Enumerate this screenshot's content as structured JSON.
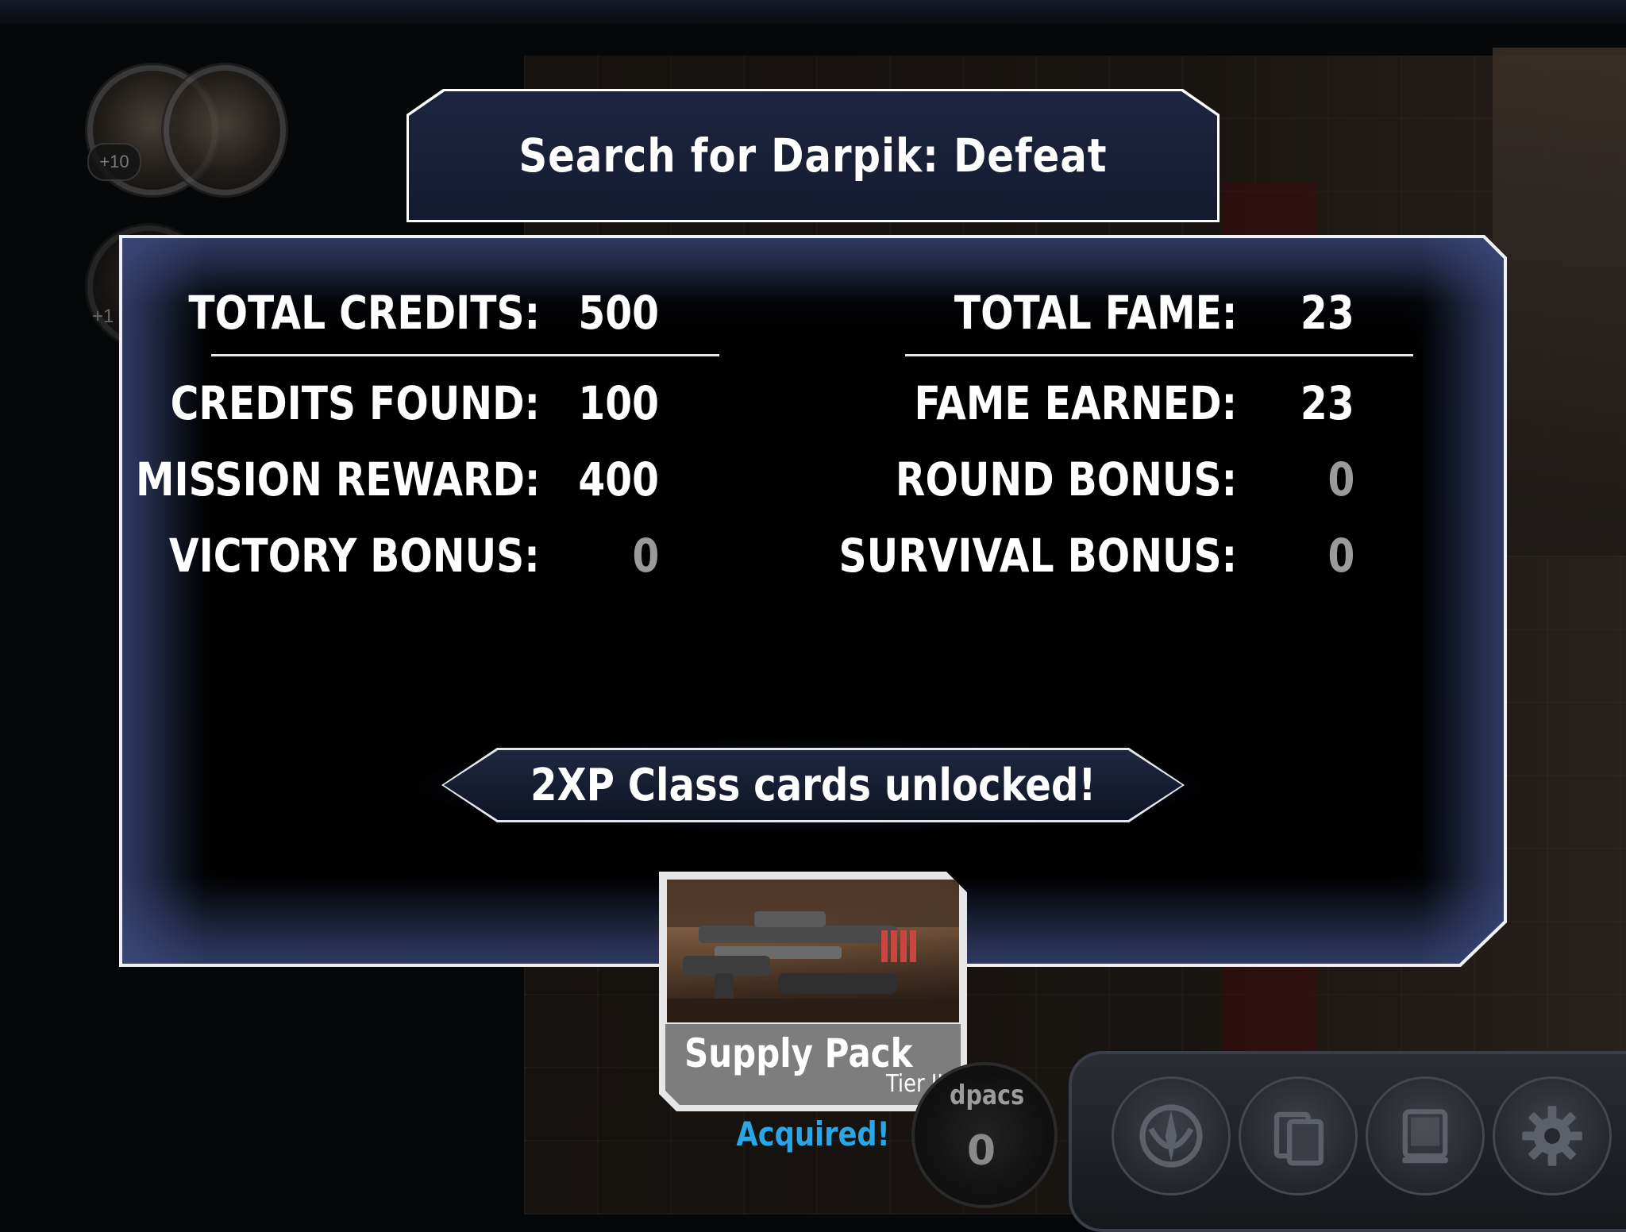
{
  "title": "Search for Darpik: Defeat",
  "credits": {
    "total_label": "TOTAL CREDITS:",
    "total_value": "500",
    "rows": [
      {
        "label": "CREDITS FOUND:",
        "value": "100"
      },
      {
        "label": "MISSION REWARD:",
        "value": "400"
      },
      {
        "label": "VICTORY BONUS:",
        "value": "0"
      }
    ]
  },
  "fame": {
    "total_label": "TOTAL FAME:",
    "total_value": "23",
    "rows": [
      {
        "label": "FAME EARNED:",
        "value": "23"
      },
      {
        "label": "ROUND BONUS:",
        "value": "0"
      },
      {
        "label": "SURVIVAL BONUS:",
        "value": "0"
      }
    ]
  },
  "unlock_message": "2XP Class cards unlocked!",
  "reward_card": {
    "name": "Supply Pack",
    "tier": "Tier III",
    "status": "Acquired!"
  },
  "hero_tokens": [
    {
      "badge": "+10"
    },
    {
      "badge": "+1"
    }
  ],
  "hud": {
    "medpacs_label": "dpacs",
    "medpacs_count": "0",
    "buttons": [
      {
        "icon": "rebel-alliance-icon"
      },
      {
        "icon": "deploy-cards-icon"
      },
      {
        "icon": "datapad-icon"
      },
      {
        "icon": "gear-icon"
      }
    ]
  },
  "colors": {
    "accent_blue": "#2aa6e6",
    "zero_value": "#9a9a9a",
    "banner_fill": "#1d2540"
  }
}
